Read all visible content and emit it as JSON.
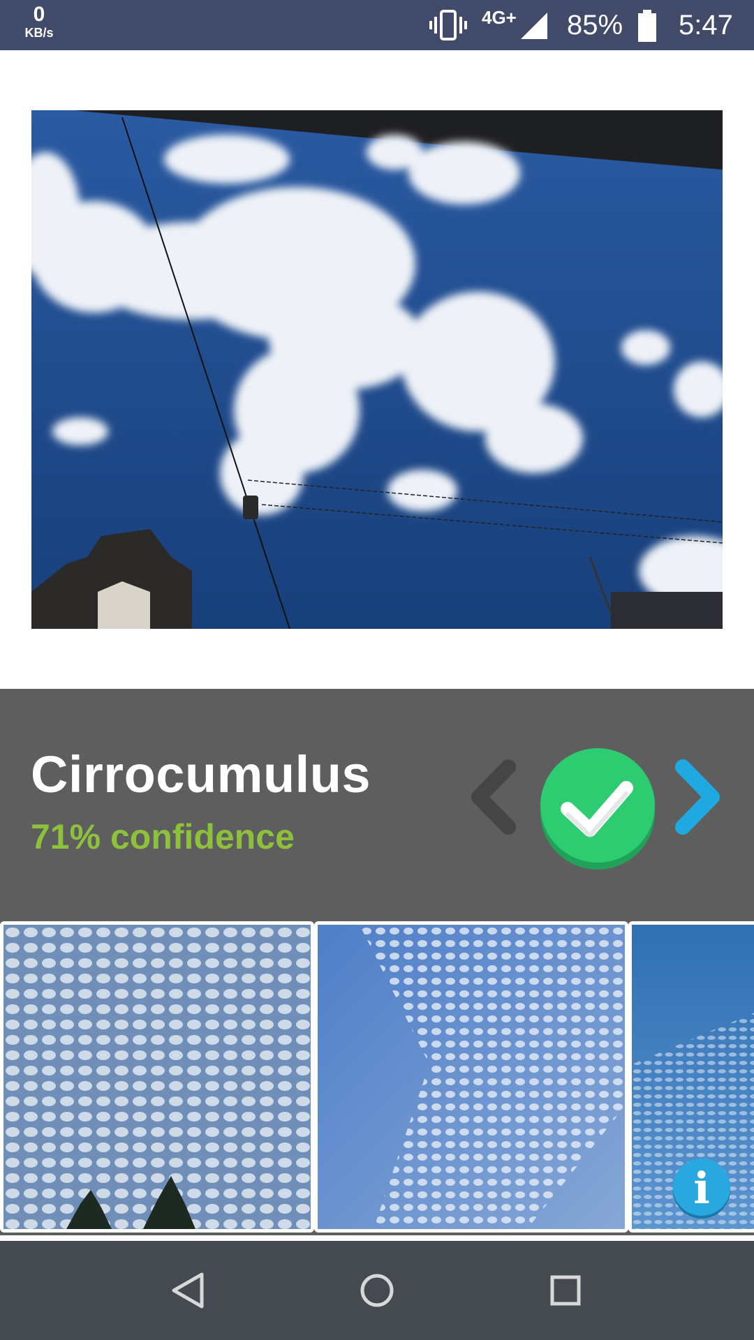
{
  "status_bar": {
    "net_speed_value": "0",
    "net_speed_unit": "KB/s",
    "network_type": "4G+",
    "battery_percent": "85%",
    "time": "5:47",
    "icons": [
      "vibrate-icon",
      "signal-icon",
      "battery-icon"
    ]
  },
  "photo": {
    "subject": "sky-with-clouds",
    "colors": {
      "sky": "#1d4a8a",
      "cloud": "#f2f5f9"
    }
  },
  "result": {
    "name": "Cirrocumulus",
    "confidence": "71% confidence",
    "colors": {
      "name": "#ffffff",
      "confidence": "#8dc13c",
      "panel": "#5e5e5e",
      "confirm": "#2ecc71",
      "next": "#1fa9e0",
      "prev": "#454545"
    },
    "icons": [
      "chevron-left-icon",
      "checkmark-icon",
      "chevron-right-icon"
    ]
  },
  "examples": {
    "count_visible": 3,
    "info_label": "i"
  },
  "nav_bar": {
    "icons": [
      "back-icon",
      "home-icon",
      "recents-icon"
    ]
  }
}
